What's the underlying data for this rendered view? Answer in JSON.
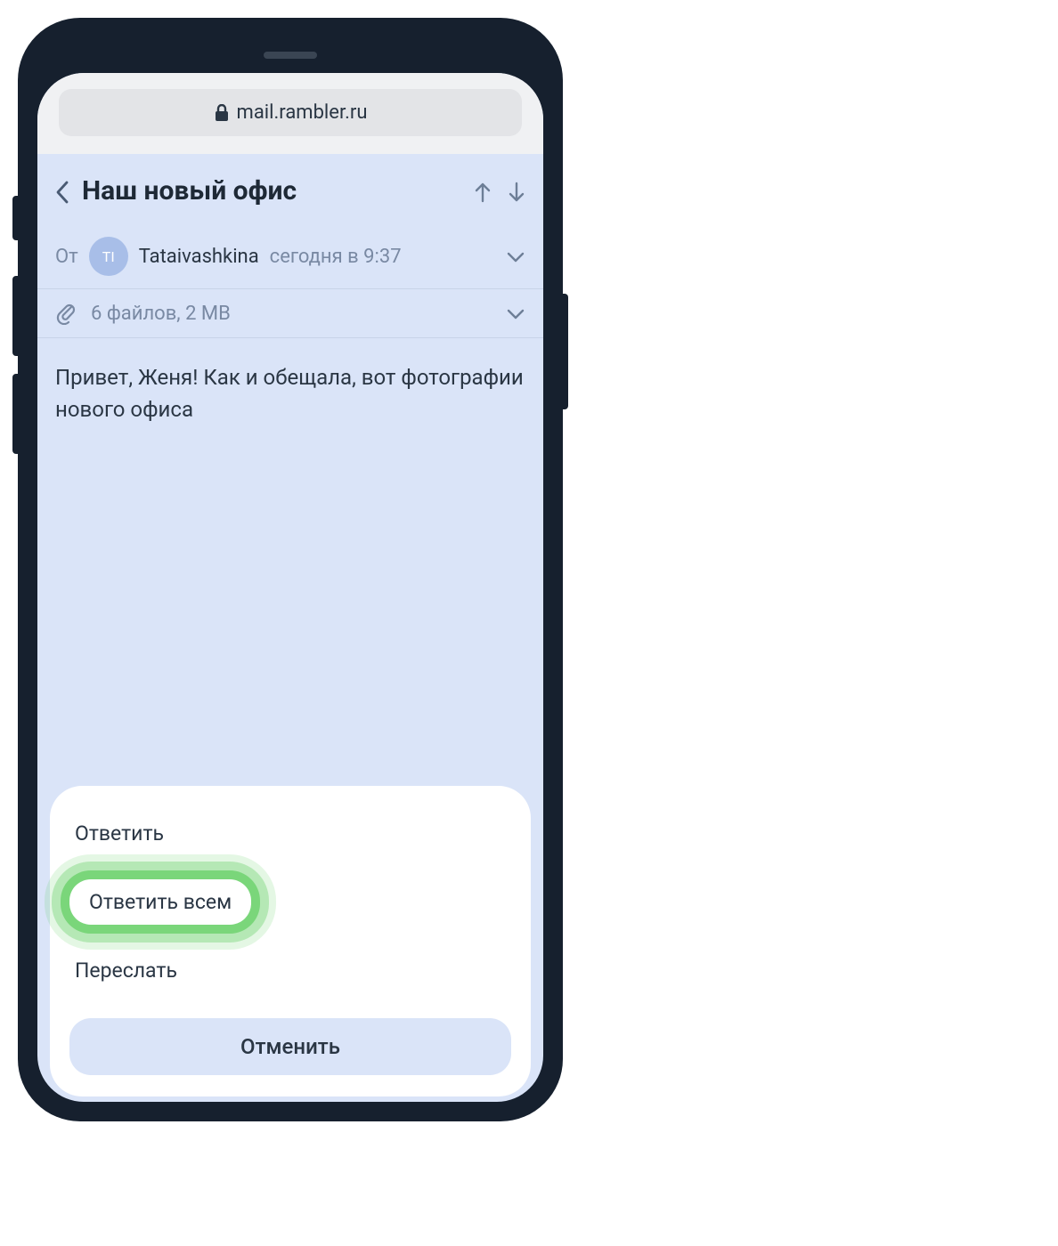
{
  "browser": {
    "url": "mail.rambler.ru"
  },
  "email": {
    "subject": "Наш новый офис",
    "from_label": "От",
    "avatar_initials": "TI",
    "sender_name": "Tataivashkina",
    "sender_time": "сегодня в 9:37",
    "attachments_summary": "6 файлов, 2 MB",
    "body": "Привет, Женя! Как и обещала, вот фотографии нового офиса"
  },
  "action_sheet": {
    "reply": "Ответить",
    "reply_all": "Ответить всем",
    "forward": "Переслать",
    "cancel": "Отменить"
  }
}
